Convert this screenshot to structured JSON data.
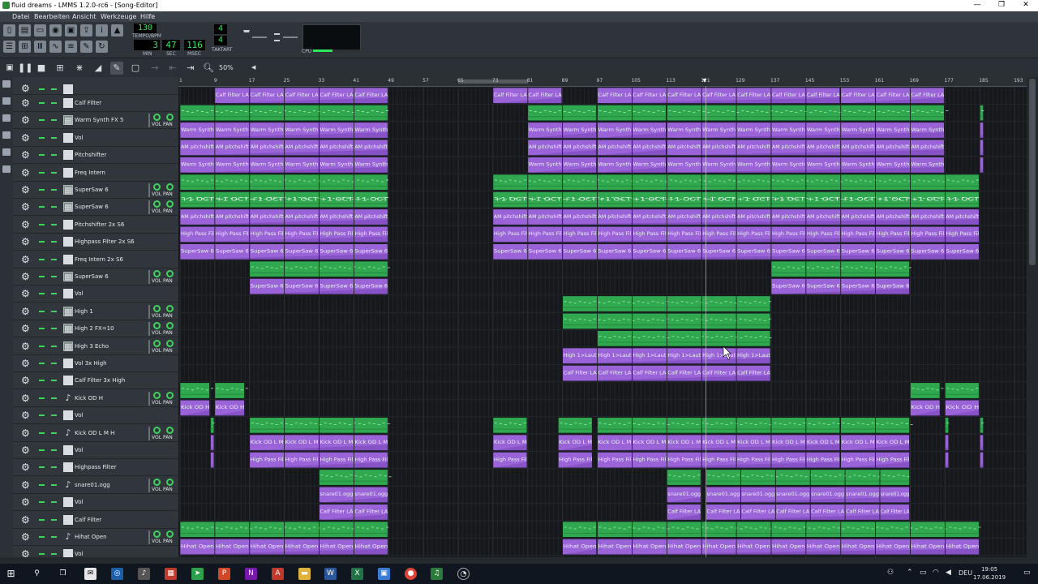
{
  "window": {
    "title": "fluid dreams - LMMS 1.2.0-rc6 - [Song-Editor]",
    "minimize": "—",
    "restore": "❐",
    "close": "✕"
  },
  "menu": [
    "Datei",
    "Bearbeiten",
    "Ansicht",
    "Werkzeuge",
    "Hilfe"
  ],
  "transport": {
    "tempo_value": "130",
    "tempo_label": "TEMPO/BPM",
    "min_value": "3",
    "sec_value": "47",
    "msec_value": "116",
    "min_label": "MIN",
    "sec_label": "SEC",
    "msec_label": "MSEC",
    "timesig_num": "4",
    "timesig_den": "4",
    "timesig_label": "TAKTART",
    "cpu_label": "CPU"
  },
  "song_editor": {
    "zoom": "50%",
    "bars": [
      "1",
      "9",
      "17",
      "25",
      "33",
      "41",
      "49",
      "57",
      "65",
      "73",
      "81",
      "89",
      "97",
      "105",
      "113",
      "121",
      "129",
      "137",
      "145",
      "153",
      "161",
      "169",
      "177",
      "185",
      "193"
    ],
    "loop": {
      "from_bar": 65,
      "to_bar": 81
    },
    "playhead_bar": 122
  },
  "tracks": [
    {
      "name": "Calf Filter",
      "kind": "auto",
      "vol_pan": false,
      "clip_label": "Calf Filter LA",
      "clips": [
        [
          9,
          49
        ],
        [
          73,
          89
        ],
        [
          97,
          153
        ],
        [
          153,
          177
        ]
      ]
    },
    {
      "name": "Warm Synth FX 5",
      "kind": "inst",
      "vol_pan": true,
      "clip_label": "",
      "clips": [
        [
          1,
          49
        ],
        [
          81,
          97
        ],
        [
          97,
          113
        ],
        [
          113,
          177
        ],
        [
          185,
          186
        ]
      ]
    },
    {
      "name": "Vol",
      "kind": "auto",
      "vol_pan": false,
      "clip_label": "Warm Synth",
      "clips": [
        [
          1,
          49
        ],
        [
          81,
          97
        ],
        [
          97,
          113
        ],
        [
          113,
          177
        ],
        [
          185,
          186
        ]
      ]
    },
    {
      "name": "Pitchshifter",
      "kind": "auto",
      "vol_pan": false,
      "clip_label": "AM pitchshift",
      "clips": [
        [
          1,
          49
        ],
        [
          81,
          97
        ],
        [
          97,
          113
        ],
        [
          113,
          177
        ],
        [
          185,
          186
        ]
      ]
    },
    {
      "name": "Freq Intern",
      "kind": "auto",
      "vol_pan": false,
      "clip_label": "Warm Synth",
      "clips": [
        [
          1,
          49
        ],
        [
          81,
          97
        ],
        [
          97,
          113
        ],
        [
          113,
          177
        ],
        [
          185,
          186
        ]
      ]
    },
    {
      "name": "SuperSaw 6",
      "kind": "inst",
      "vol_pan": true,
      "clip_label": "",
      "clips": [
        [
          1,
          49
        ],
        [
          73,
          185
        ]
      ]
    },
    {
      "name": "SuperSaw 6",
      "kind": "inst",
      "vol_pan": true,
      "clip_label": "+1 OCT",
      "clips": [
        [
          1,
          49
        ],
        [
          73,
          185
        ]
      ]
    },
    {
      "name": "Pitchshifter 2x S6",
      "kind": "auto",
      "vol_pan": false,
      "clip_label": "AM pitchshift",
      "clips": [
        [
          1,
          49
        ],
        [
          73,
          185
        ]
      ]
    },
    {
      "name": "Highpass Filter 2x S6",
      "kind": "auto",
      "vol_pan": false,
      "clip_label": "High Pass Fil",
      "clips": [
        [
          1,
          49
        ],
        [
          73,
          185
        ]
      ]
    },
    {
      "name": "Freq Intern 2x S6",
      "kind": "auto",
      "vol_pan": false,
      "clip_label": "SuperSaw 6",
      "clips": [
        [
          1,
          49
        ],
        [
          73,
          185
        ]
      ]
    },
    {
      "name": "SuperSaw 6",
      "kind": "inst",
      "vol_pan": true,
      "clip_label": "",
      "clips": [
        [
          17,
          49
        ],
        [
          137,
          169
        ]
      ]
    },
    {
      "name": "Vol",
      "kind": "auto",
      "vol_pan": false,
      "clip_label": "SuperSaw 6",
      "clips": [
        [
          17,
          49
        ],
        [
          137,
          169
        ]
      ]
    },
    {
      "name": "High 1",
      "kind": "inst",
      "vol_pan": true,
      "clip_label": "",
      "clips": [
        [
          89,
          137
        ]
      ]
    },
    {
      "name": "High 2 FX=10",
      "kind": "inst",
      "vol_pan": true,
      "clip_label": "",
      "clips": [
        [
          89,
          137
        ]
      ]
    },
    {
      "name": "High 3 Echo",
      "kind": "inst",
      "vol_pan": true,
      "clip_label": "",
      "clips": [
        [
          97,
          137
        ]
      ]
    },
    {
      "name": "Vol 3x High",
      "kind": "auto",
      "vol_pan": false,
      "clip_label": "High 1>Laut",
      "clips": [
        [
          89,
          137
        ]
      ]
    },
    {
      "name": "Calf Filter 3x High",
      "kind": "auto",
      "vol_pan": false,
      "clip_label": "Calf Filter LA",
      "clips": [
        [
          89,
          137
        ]
      ]
    },
    {
      "name": "Kick OD H",
      "kind": "beat",
      "vol_pan": true,
      "clip_label": "",
      "clips": [
        [
          1,
          8
        ],
        [
          9,
          16
        ],
        [
          169,
          176
        ],
        [
          177,
          185
        ]
      ]
    },
    {
      "name": "Vol",
      "kind": "auto",
      "vol_pan": false,
      "clip_label": "Kick OD H",
      "clips": [
        [
          1,
          8
        ],
        [
          9,
          16
        ],
        [
          169,
          176
        ],
        [
          177,
          185
        ]
      ]
    },
    {
      "name": "Kick OD L M H",
      "kind": "beat",
      "vol_pan": true,
      "clip_label": "",
      "clips": [
        [
          8,
          9
        ],
        [
          17,
          49
        ],
        [
          73,
          81
        ],
        [
          88,
          96
        ],
        [
          97,
          153
        ],
        [
          153,
          169
        ],
        [
          177,
          178
        ],
        [
          185,
          186
        ]
      ]
    },
    {
      "name": "Vol",
      "kind": "auto",
      "vol_pan": false,
      "clip_label": "Kick OD L M",
      "clips": [
        [
          8,
          9
        ],
        [
          17,
          49
        ],
        [
          73,
          81
        ],
        [
          88,
          96
        ],
        [
          97,
          153
        ],
        [
          153,
          169
        ],
        [
          177,
          178
        ],
        [
          185,
          186
        ]
      ]
    },
    {
      "name": "Highpass Filter",
      "kind": "auto",
      "vol_pan": false,
      "clip_label": "High Pass Fil",
      "clips": [
        [
          8,
          9
        ],
        [
          17,
          49
        ],
        [
          73,
          81
        ],
        [
          88,
          96
        ],
        [
          97,
          153
        ],
        [
          153,
          169
        ],
        [
          177,
          178
        ],
        [
          185,
          186
        ]
      ]
    },
    {
      "name": "snare01.ogg",
      "kind": "beat",
      "vol_pan": true,
      "clip_label": "",
      "clips": [
        [
          33,
          49
        ],
        [
          113,
          121
        ],
        [
          122,
          169
        ]
      ]
    },
    {
      "name": "Vol",
      "kind": "auto",
      "vol_pan": false,
      "clip_label": "snare01.ogg",
      "clips": [
        [
          33,
          49
        ],
        [
          113,
          121
        ],
        [
          122,
          169
        ]
      ]
    },
    {
      "name": "Calf Filter",
      "kind": "auto",
      "vol_pan": false,
      "clip_label": "Calf Filter LA",
      "clips": [
        [
          33,
          49
        ],
        [
          113,
          121
        ],
        [
          122,
          169
        ]
      ]
    },
    {
      "name": "Hihat Open",
      "kind": "beat",
      "vol_pan": true,
      "clip_label": "",
      "clips": [
        [
          1,
          49
        ],
        [
          89,
          97
        ],
        [
          97,
          185
        ]
      ]
    },
    {
      "name": "Vol",
      "kind": "auto",
      "vol_pan": false,
      "clip_label": "Hihat Open",
      "clips": [
        [
          1,
          49
        ],
        [
          89,
          97
        ],
        [
          97,
          185
        ]
      ]
    }
  ],
  "colors": {
    "instrument_clip": "#2fa84f",
    "automation_clip": "#9a63d8",
    "background": "#16181c",
    "lcd_text": "#2fe65f"
  },
  "taskbar": {
    "clock_time": "19:05",
    "clock_date": "17.06.2019",
    "language": "DEU"
  }
}
